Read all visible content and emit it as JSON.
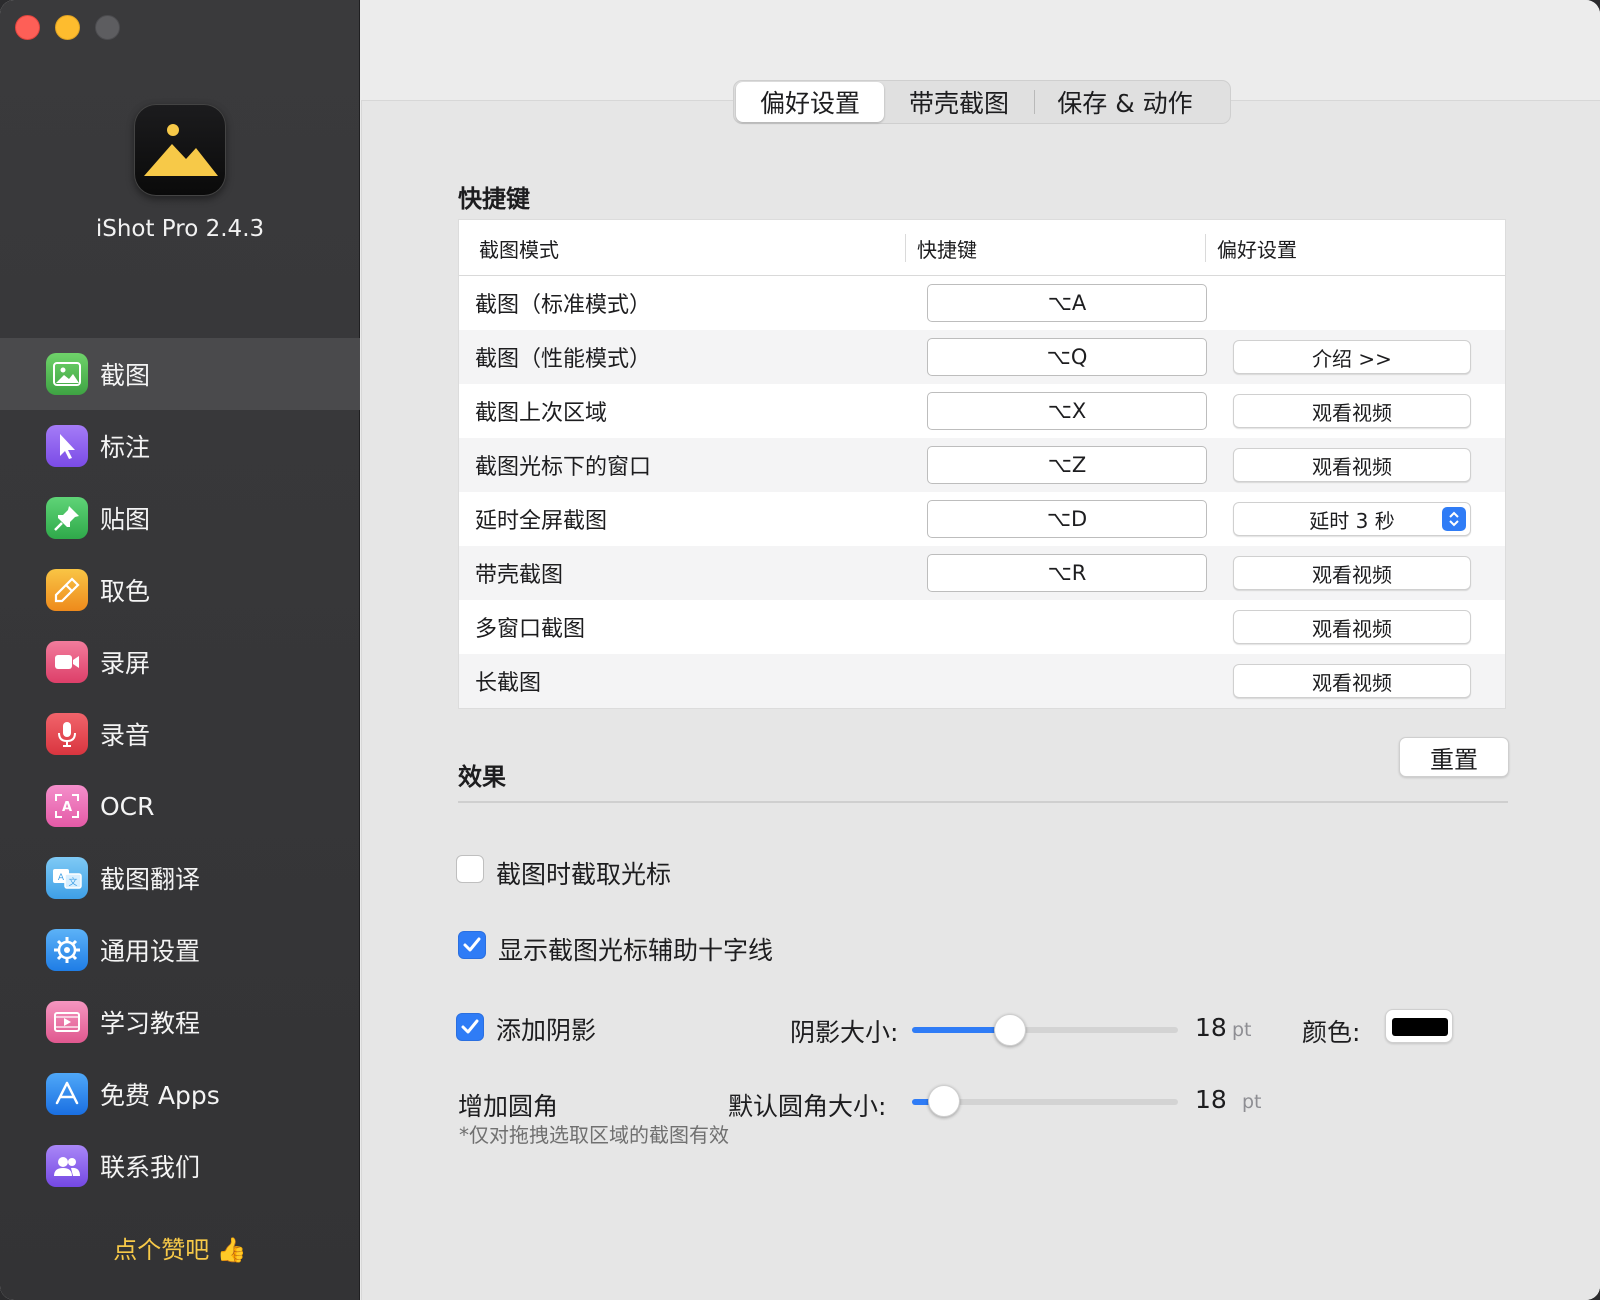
{
  "app": {
    "name": "iShot Pro 2.4.3",
    "like_label": "点个赞吧 👍"
  },
  "sidebar": {
    "items": [
      {
        "label": "截图",
        "icon": "screenshot-icon",
        "color": "#4caf50",
        "active": true
      },
      {
        "label": "标注",
        "icon": "cursor-arrow-icon",
        "color": "#8e5cf0"
      },
      {
        "label": "贴图",
        "icon": "pin-icon",
        "color": "#3dbb5c"
      },
      {
        "label": "取色",
        "icon": "eyedropper-icon",
        "color": "#f0a020"
      },
      {
        "label": "录屏",
        "icon": "video-camera-icon",
        "color": "#e9537a"
      },
      {
        "label": "录音",
        "icon": "microphone-icon",
        "color": "#e9464f"
      },
      {
        "label": "OCR",
        "icon": "ocr-scan-icon",
        "color": "#ef6fb8"
      },
      {
        "label": "截图翻译",
        "icon": "translate-icon",
        "color": "#57b6f0"
      },
      {
        "label": "通用设置",
        "icon": "gear-icon",
        "color": "#2f8ff0"
      },
      {
        "label": "学习教程",
        "icon": "tutorial-film-icon",
        "color": "#ea6aa0"
      },
      {
        "label": "免费 Apps",
        "icon": "app-store-icon",
        "color": "#2a88f0"
      },
      {
        "label": "联系我们",
        "icon": "contacts-icon",
        "color": "#8a64ee"
      }
    ]
  },
  "tabs": [
    {
      "label": "偏好设置",
      "active": true
    },
    {
      "label": "带壳截图"
    },
    {
      "label": "保存 & 动作"
    }
  ],
  "shortcuts": {
    "title": "快捷键",
    "headers": [
      "截图模式",
      "快捷键",
      "偏好设置"
    ],
    "rows": [
      {
        "mode": "截图（标准模式）",
        "key": "⌥A",
        "pref": ""
      },
      {
        "mode": "截图（性能模式）",
        "key": "⌥Q",
        "pref": "介绍  >>"
      },
      {
        "mode": "截图上次区域",
        "key": "⌥X",
        "pref": "观看视频"
      },
      {
        "mode": "截图光标下的窗口",
        "key": "⌥Z",
        "pref": "观看视频"
      },
      {
        "mode": "延时全屏截图",
        "key": "⌥D",
        "pref": "延时 3 秒",
        "pref_type": "select"
      },
      {
        "mode": "带壳截图",
        "key": "⌥R",
        "pref": "观看视频"
      },
      {
        "mode": "多窗口截图",
        "key": "",
        "pref": "观看视频"
      },
      {
        "mode": "长截图",
        "key": "",
        "pref": "观看视频"
      }
    ],
    "reset_label": "重置"
  },
  "effects": {
    "title": "效果",
    "capture_cursor": {
      "label": "截图时截取光标",
      "checked": false
    },
    "crosshair": {
      "label": "显示截图光标辅助十字线",
      "checked": true
    },
    "shadow": {
      "label": "添加阴影",
      "checked": true,
      "size_label": "阴影大小:",
      "value": "18",
      "unit": "pt",
      "fraction": 0.37,
      "color_label": "颜色:",
      "color": "#000000"
    },
    "corner": {
      "label": "增加圆角",
      "size_label": "默认圆角大小:",
      "value": "18",
      "unit": "pt",
      "fraction": 0.12
    },
    "note": "*仅对拖拽选取区域的截图有效"
  },
  "colors": {
    "accent": "#2f7cf6",
    "like": "#f7c948"
  }
}
